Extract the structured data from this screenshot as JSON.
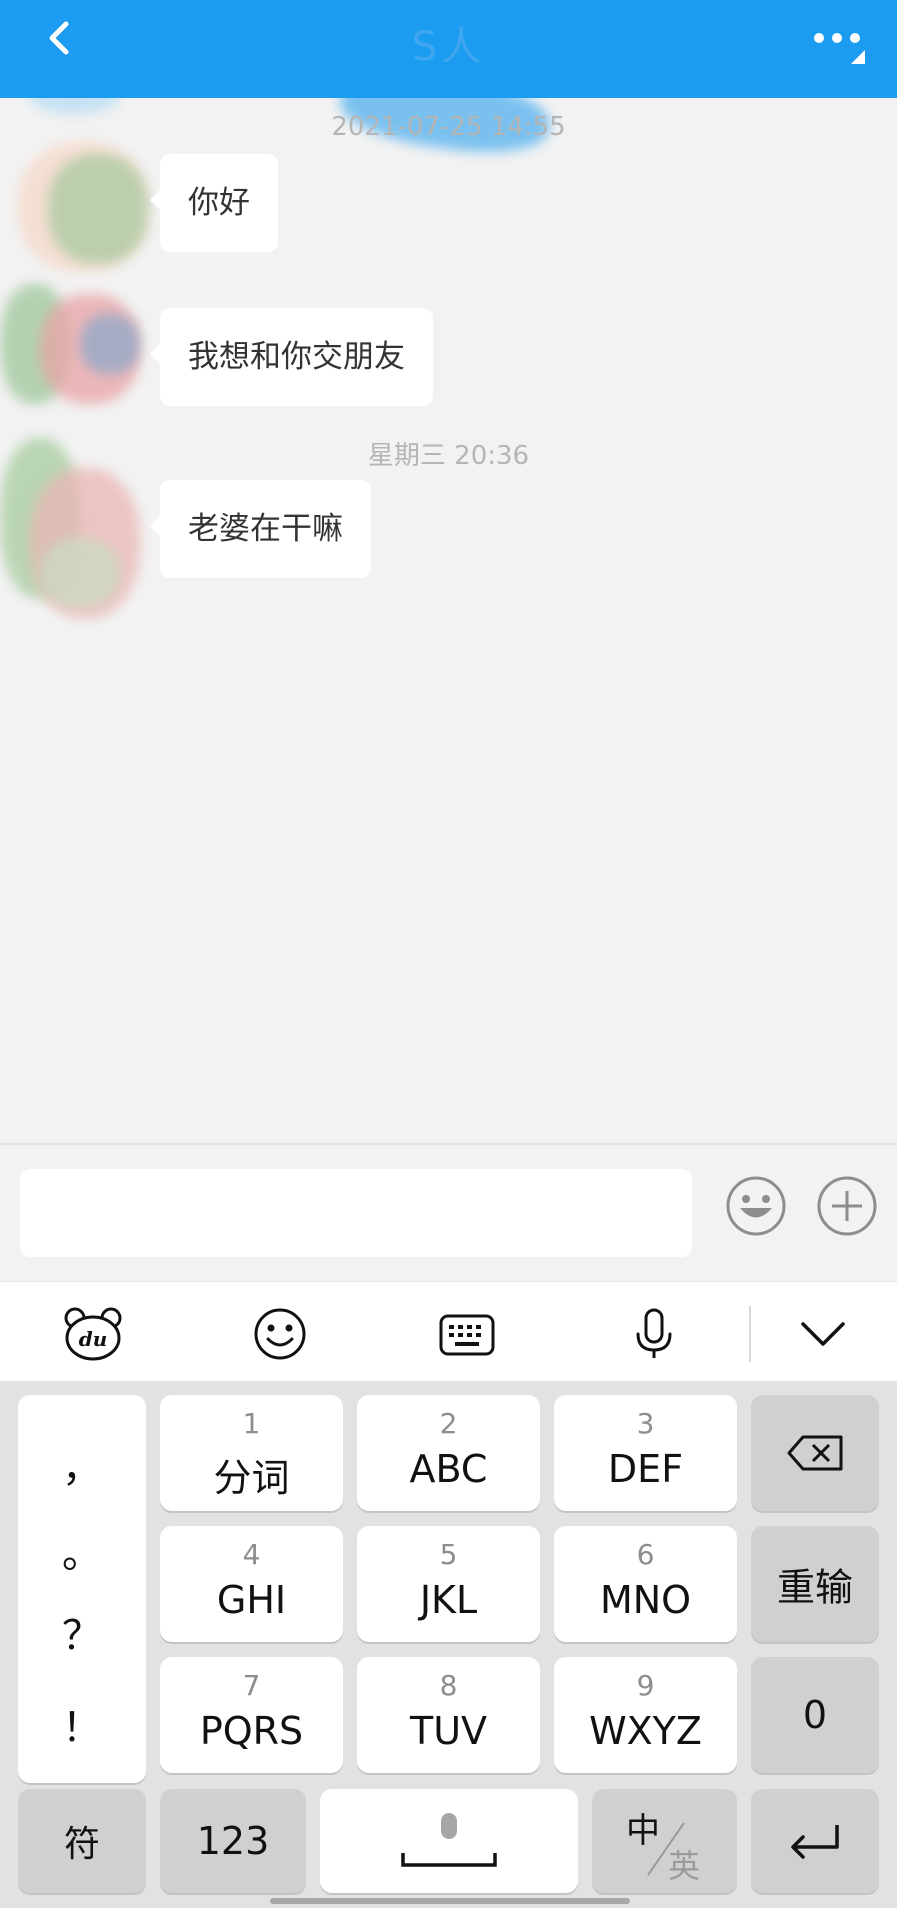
{
  "header": {
    "title": "S人",
    "back_icon": "chevron-left-icon",
    "more_icon": "more-dots-icon"
  },
  "colors": {
    "header_bg": "#1c9cf0",
    "chat_bg": "#f2f2f2",
    "bubble_bg": "#ffffff",
    "keyboard_bg": "#e2e2e2"
  },
  "chat": {
    "timestamps": [
      "2021-07-25 14:55",
      "星期三 20:36"
    ],
    "messages": [
      {
        "text": "你好"
      },
      {
        "text": "我想和你交朋友"
      },
      {
        "text": "老婆在干嘛"
      }
    ]
  },
  "input": {
    "value": "",
    "placeholder": "",
    "emoji_icon": "smiley-icon",
    "plus_icon": "plus-icon"
  },
  "toolbar": {
    "icons": [
      "du-bear-icon",
      "emoji-face-icon",
      "keyboard-icon",
      "microphone-icon",
      "chevron-down-icon"
    ]
  },
  "keyboard": {
    "punctuation": [
      "，",
      "。",
      "？",
      "！"
    ],
    "keys": [
      {
        "num": "1",
        "letters": "分词"
      },
      {
        "num": "2",
        "letters": "ABC"
      },
      {
        "num": "3",
        "letters": "DEF"
      },
      {
        "num": "4",
        "letters": "GHI"
      },
      {
        "num": "5",
        "letters": "JKL"
      },
      {
        "num": "6",
        "letters": "MNO"
      },
      {
        "num": "7",
        "letters": "PQRS"
      },
      {
        "num": "8",
        "letters": "TUV"
      },
      {
        "num": "9",
        "letters": "WXYZ"
      }
    ],
    "reset_label": "重输",
    "zero_label": "0",
    "symbol_label": "符",
    "numbers_label": "123",
    "lang_cn": "中",
    "lang_en": "英",
    "backspace_icon": "backspace-icon",
    "enter_icon": "return-icon",
    "space_icon": "space-mic-icon"
  }
}
